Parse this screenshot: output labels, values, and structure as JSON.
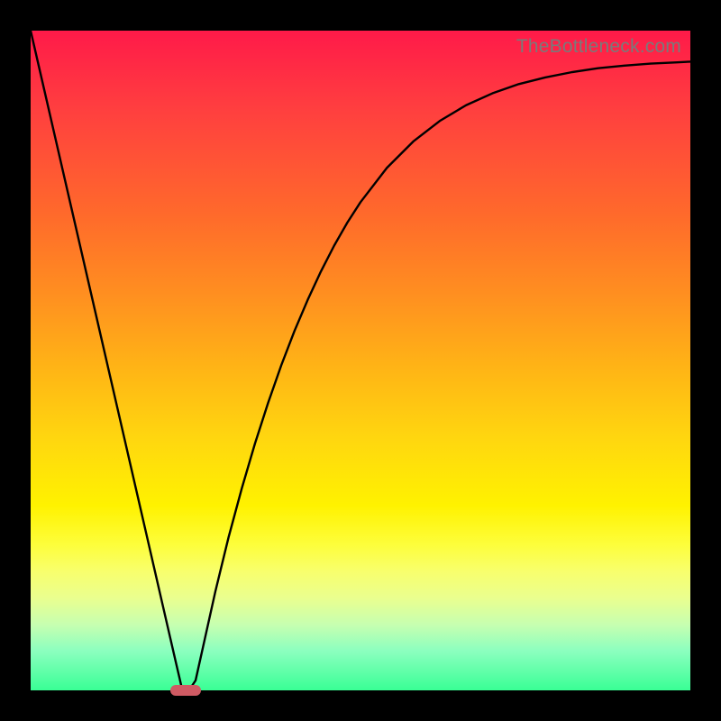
{
  "watermark": "TheBottleneck.com",
  "colors": {
    "frame": "#000000",
    "curve": "#000000",
    "marker": "#cf5a63",
    "gradient_top": "#ff1a49",
    "gradient_bottom": "#39ff95"
  },
  "chart_data": {
    "type": "line",
    "title": "",
    "xlabel": "",
    "ylabel": "",
    "xlim": [
      0,
      100
    ],
    "ylim": [
      0,
      100
    ],
    "grid": false,
    "legend": false,
    "x": [
      0,
      2,
      4,
      6,
      8,
      10,
      12,
      14,
      16,
      18,
      20,
      22,
      23,
      24,
      25,
      26,
      28,
      30,
      32,
      34,
      36,
      38,
      40,
      42,
      44,
      46,
      48,
      50,
      54,
      58,
      62,
      66,
      70,
      74,
      78,
      82,
      86,
      90,
      94,
      98,
      100
    ],
    "values": [
      100,
      91.3,
      82.6,
      73.9,
      65.2,
      56.5,
      47.8,
      39.1,
      30.4,
      21.7,
      13.0,
      4.3,
      0,
      0,
      1.5,
      6.0,
      15.0,
      23.2,
      30.6,
      37.4,
      43.6,
      49.3,
      54.5,
      59.2,
      63.5,
      67.4,
      70.9,
      74.0,
      79.2,
      83.2,
      86.3,
      88.7,
      90.5,
      91.9,
      92.9,
      93.7,
      94.3,
      94.7,
      95.0,
      95.2,
      95.3
    ],
    "annotations": [
      {
        "type": "marker",
        "x": 23.5,
        "y": 0.0,
        "shape": "pill"
      }
    ]
  }
}
